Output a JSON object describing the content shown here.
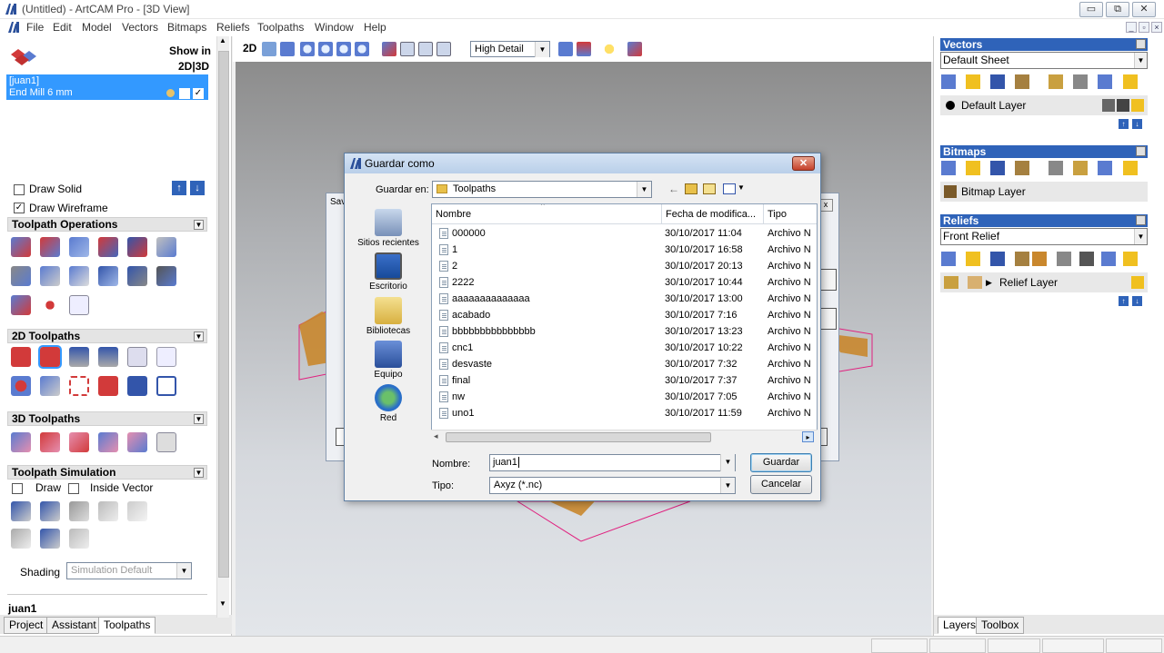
{
  "window": {
    "title": "(Untitled) - ArtCAM Pro - [3D View]",
    "controls": [
      "minimize",
      "restore",
      "close"
    ]
  },
  "menu": [
    "File",
    "Edit",
    "Model",
    "Vectors",
    "Bitmaps",
    "Reliefs",
    "Toolpaths",
    "Window",
    "Help"
  ],
  "left_panel": {
    "show_in_label": "Show in",
    "show_in_modes": "2D|3D",
    "selected_toolpath": {
      "name": "[juan1]",
      "tool": "End Mill 6 mm"
    },
    "draw_solid_label": "Draw Solid",
    "draw_solid_checked": false,
    "draw_wireframe_label": "Draw Wireframe",
    "draw_wireframe_checked": true,
    "sections": {
      "ops": "Toolpath Operations",
      "twod": "2D Toolpaths",
      "threed": "3D Toolpaths",
      "sim": "Toolpath Simulation"
    },
    "sim_draw_label": "Draw",
    "sim_inside_vector_label": "Inside Vector",
    "shading_label": "Shading",
    "shading_value": "Simulation Default",
    "footer_name": "juan1",
    "tabs": [
      "Project",
      "Assistant",
      "Toolpaths"
    ],
    "active_tab": "Toolpaths"
  },
  "toolbar3d": {
    "view_label": "2D",
    "detail_value": "High Detail"
  },
  "right_panel": {
    "vectors": {
      "title": "Vectors",
      "sheet": "Default Sheet",
      "layer": "Default Layer"
    },
    "bitmaps": {
      "title": "Bitmaps",
      "layer": "Bitmap Layer"
    },
    "reliefs": {
      "title": "Reliefs",
      "selector": "Front Relief",
      "layer": "Relief Layer"
    },
    "tabs": [
      "Layers",
      "Toolbox"
    ],
    "active_tab": "Layers"
  },
  "back_dialog": {
    "title_fragment": "Sav"
  },
  "dialog": {
    "title": "Guardar como",
    "save_in_label": "Guardar en:",
    "save_in_value": "Toolpaths",
    "places": [
      "Sitios recientes",
      "Escritorio",
      "Bibliotecas",
      "Equipo",
      "Red"
    ],
    "columns": {
      "name": "Nombre",
      "date": "Fecha de modifica...",
      "type": "Tipo"
    },
    "files": [
      {
        "name": "000000",
        "date": "30/10/2017 11:04",
        "type": "Archivo N"
      },
      {
        "name": "1",
        "date": "30/10/2017 16:58",
        "type": "Archivo N"
      },
      {
        "name": "2",
        "date": "30/10/2017 20:13",
        "type": "Archivo N"
      },
      {
        "name": "2222",
        "date": "30/10/2017 10:44",
        "type": "Archivo N"
      },
      {
        "name": "aaaaaaaaaaaaaa",
        "date": "30/10/2017 13:00",
        "type": "Archivo N"
      },
      {
        "name": "acabado",
        "date": "30/10/2017 7:16",
        "type": "Archivo N"
      },
      {
        "name": "bbbbbbbbbbbbbbb",
        "date": "30/10/2017 13:23",
        "type": "Archivo N"
      },
      {
        "name": "cnc1",
        "date": "30/10/2017 10:22",
        "type": "Archivo N"
      },
      {
        "name": "desvaste",
        "date": "30/10/2017 7:32",
        "type": "Archivo N"
      },
      {
        "name": "final",
        "date": "30/10/2017 7:37",
        "type": "Archivo N"
      },
      {
        "name": "nw",
        "date": "30/10/2017 7:05",
        "type": "Archivo N"
      },
      {
        "name": "uno1",
        "date": "30/10/2017 11:59",
        "type": "Archivo N"
      }
    ],
    "filename_label": "Nombre:",
    "filename_value": "juan1",
    "type_label": "Tipo:",
    "type_value": "Axyz (*.nc)",
    "save_button": "Guardar",
    "cancel_button": "Cancelar"
  },
  "colors": {
    "accent_blue": "#2f63b9",
    "selection_blue": "#3399ff",
    "wireframe_magenta": "#e0207f",
    "relief_orange": "#c9872d"
  }
}
